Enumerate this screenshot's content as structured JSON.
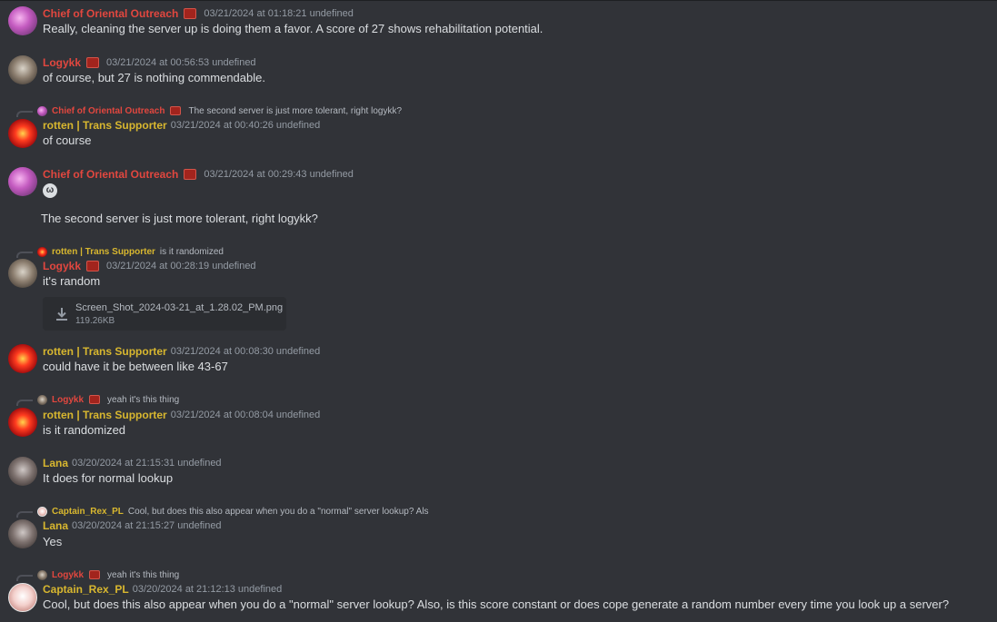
{
  "messages": [
    {
      "author": "Chief of Oriental Outreach",
      "timestamp": "03/21/2024 at 01:18:21 undefined",
      "text": "Really, cleaning the server up is doing them a favor. A score of 27 shows rehabilitation potential."
    },
    {
      "author": "Logykk",
      "timestamp": "03/21/2024 at 00:56:53 undefined",
      "text": "of course, but 27 is nothing commendable."
    },
    {
      "reply": {
        "author": "Chief of Oriental Outreach",
        "text": "The second server is just more tolerant, right logykk?"
      },
      "author": "rotten | Trans Supporter",
      "timestamp": "03/21/2024 at 00:40:26 undefined",
      "text": "of course"
    },
    {
      "author": "Chief of Oriental Outreach",
      "timestamp": "03/21/2024 at 00:29:43 undefined",
      "emoji_icon": "smiling-imp-emoji",
      "emoji_glyph": "ω",
      "text": "The second server is just more tolerant, right logykk?"
    },
    {
      "reply": {
        "author": "rotten | Trans Supporter",
        "text": "is it randomized"
      },
      "author": "Logykk",
      "timestamp": "03/21/2024 at 00:28:19 undefined",
      "text": "it's random",
      "attachment": {
        "filename": "Screen_Shot_2024-03-21_at_1.28.02_PM.png",
        "size": "119.26KB",
        "icon": "download-icon"
      }
    },
    {
      "author": "rotten | Trans Supporter",
      "timestamp": "03/21/2024 at 00:08:30 undefined",
      "text": "could have it be between like 43-67"
    },
    {
      "reply": {
        "author": "Logykk",
        "text": "yeah it's this thing"
      },
      "author": "rotten | Trans Supporter",
      "timestamp": "03/21/2024 at 00:08:04 undefined",
      "text": "is it randomized"
    },
    {
      "author": "Lana",
      "timestamp": "03/20/2024 at 21:15:31 undefined",
      "text": "It does for normal lookup"
    },
    {
      "reply": {
        "author": "Captain_Rex_PL",
        "text": "Cool, but does this also appear when you do a \"normal\" server lookup? Als"
      },
      "author": "Lana",
      "timestamp": "03/20/2024 at 21:15:27 undefined",
      "text": "Yes"
    },
    {
      "reply": {
        "author": "Logykk",
        "text": "yeah it's this thing"
      },
      "author": "Captain_Rex_PL",
      "timestamp": "03/20/2024 at 21:12:13 undefined",
      "text": "Cool, but does this also appear when you do a \"normal\" server lookup? Also, is this score constant or does cope generate a random number every time you look up a server?"
    }
  ],
  "colors": {
    "background": "#313338",
    "name_red": "#e2473f",
    "name_yellow": "#d8b72f",
    "timestamp": "#949ba4",
    "text": "#dbdee1"
  }
}
